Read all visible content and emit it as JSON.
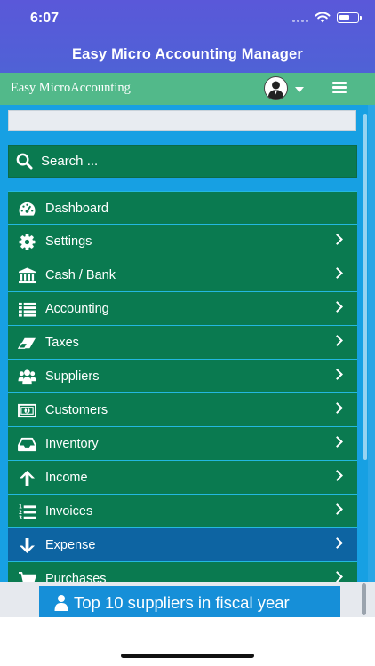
{
  "status_bar": {
    "time": "6:07"
  },
  "app": {
    "title": "Easy Micro Accounting Manager"
  },
  "header": {
    "brand": "Easy MicroAccounting"
  },
  "search": {
    "placeholder": "Search ..."
  },
  "menu": [
    {
      "label": "Dashboard",
      "icon": "dashboard-gauge-icon",
      "has_chevron": false,
      "active": false
    },
    {
      "label": "Settings",
      "icon": "gear-icon",
      "has_chevron": true,
      "active": false
    },
    {
      "label": "Cash / Bank",
      "icon": "bank-icon",
      "has_chevron": true,
      "active": false
    },
    {
      "label": "Accounting",
      "icon": "list-icon",
      "has_chevron": true,
      "active": false
    },
    {
      "label": "Taxes",
      "icon": "eraser-icon",
      "has_chevron": true,
      "active": false
    },
    {
      "label": "Suppliers",
      "icon": "users-icon",
      "has_chevron": true,
      "active": false
    },
    {
      "label": "Customers",
      "icon": "money-bill-icon",
      "has_chevron": true,
      "active": false
    },
    {
      "label": "Inventory",
      "icon": "inbox-icon",
      "has_chevron": true,
      "active": false
    },
    {
      "label": "Income",
      "icon": "arrow-up-icon",
      "has_chevron": true,
      "active": false
    },
    {
      "label": "Invoices",
      "icon": "numbered-list-icon",
      "has_chevron": true,
      "active": false
    },
    {
      "label": "Expense",
      "icon": "arrow-down-icon",
      "has_chevron": true,
      "active": true
    },
    {
      "label": "Purchases",
      "icon": "shopping-cart-icon",
      "has_chevron": true,
      "active": false
    }
  ],
  "widget": {
    "title": "Top 10 suppliers in fiscal year"
  },
  "colors": {
    "top_bar": "#5a58d9",
    "nav_bar": "#52b98a",
    "panel": "#17a0e3",
    "menu_item": "#0a7a50",
    "menu_active": "#0d64a2",
    "widget": "#168fd8"
  }
}
